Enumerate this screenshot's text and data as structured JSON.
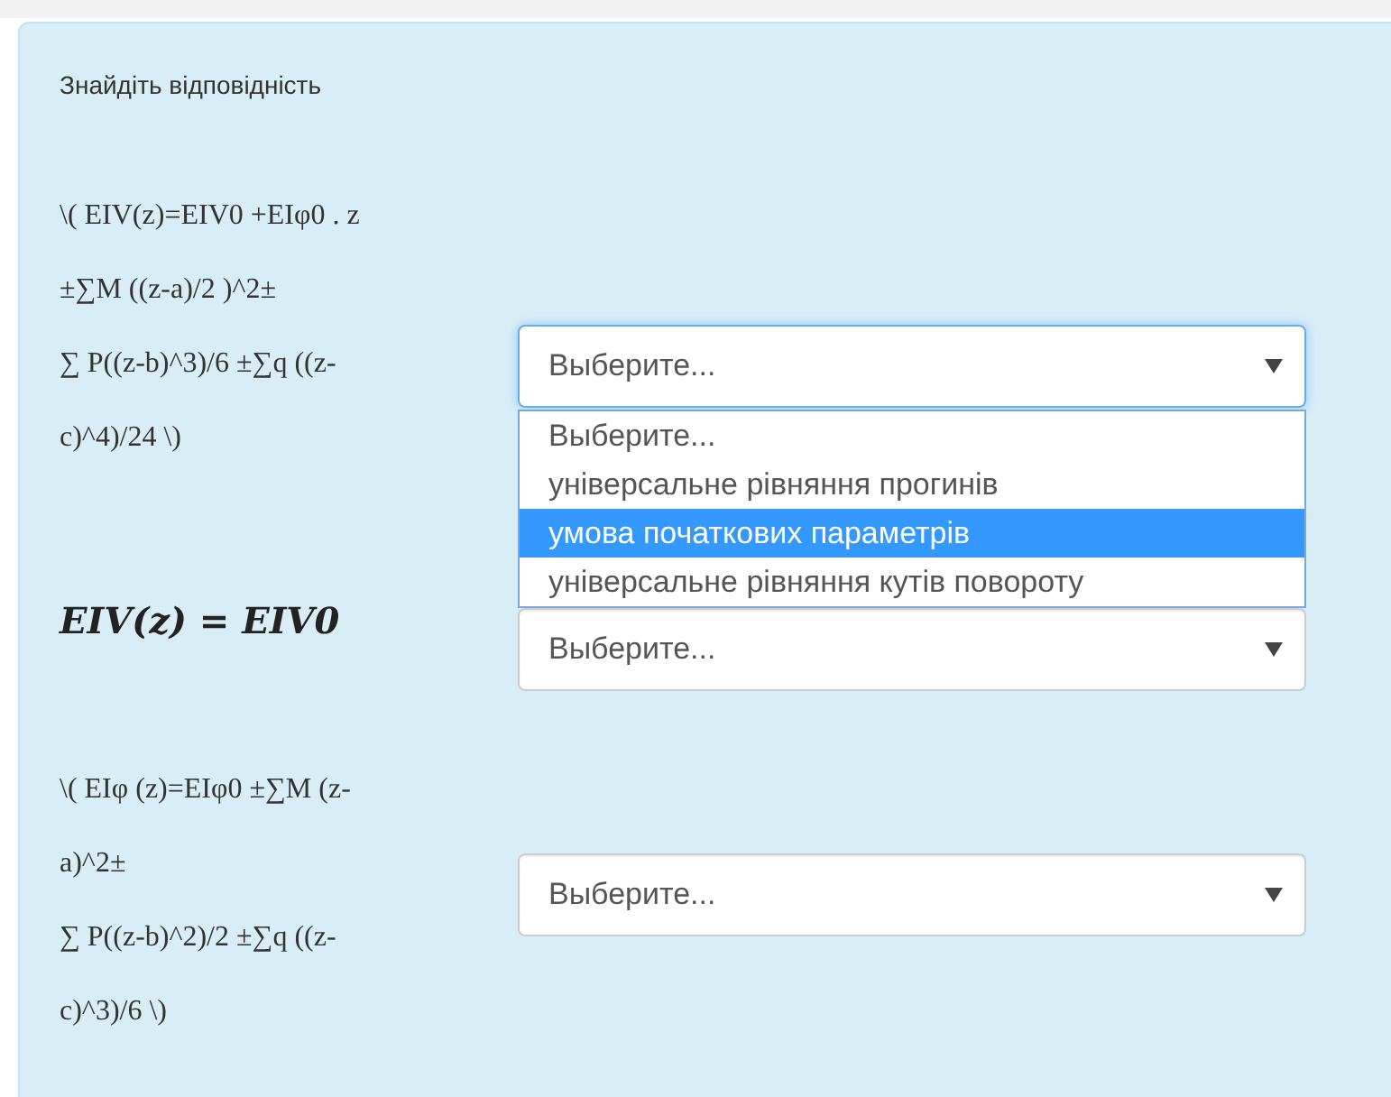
{
  "title": "Знайдіть відповідність",
  "rows": [
    {
      "kind": "text",
      "lines": [
        "\\( EIV(z)=EIV0 +EIφ0 . z",
        "±∑M ((z-a)/2 )^2±",
        "∑ P((z-b)^3)/6 ±∑q ((z-",
        "c)^4)/24 \\)"
      ],
      "select": {
        "value": "Выберите...",
        "expanded": true,
        "options": [
          {
            "label": "Выберите...",
            "highlighted": false
          },
          {
            "label": "універсальне рівняння прогинів",
            "highlighted": false
          },
          {
            "label": "умова початкових параметрів",
            "highlighted": true
          },
          {
            "label": "універсальне рівняння кутів повороту",
            "highlighted": false
          }
        ]
      }
    },
    {
      "kind": "math",
      "lines": [
        "EIV(z) = EIV0"
      ],
      "select": {
        "value": "Выберите...",
        "expanded": false
      }
    },
    {
      "kind": "text",
      "lines": [
        "\\( EIφ (z)=EIφ0 ±∑M (z-",
        "a)^2±",
        "∑ P((z-b)^2)/2 ±∑q ((z-",
        "c)^3)/6 \\)"
      ],
      "select": {
        "value": "Выберите...",
        "expanded": false
      }
    }
  ]
}
